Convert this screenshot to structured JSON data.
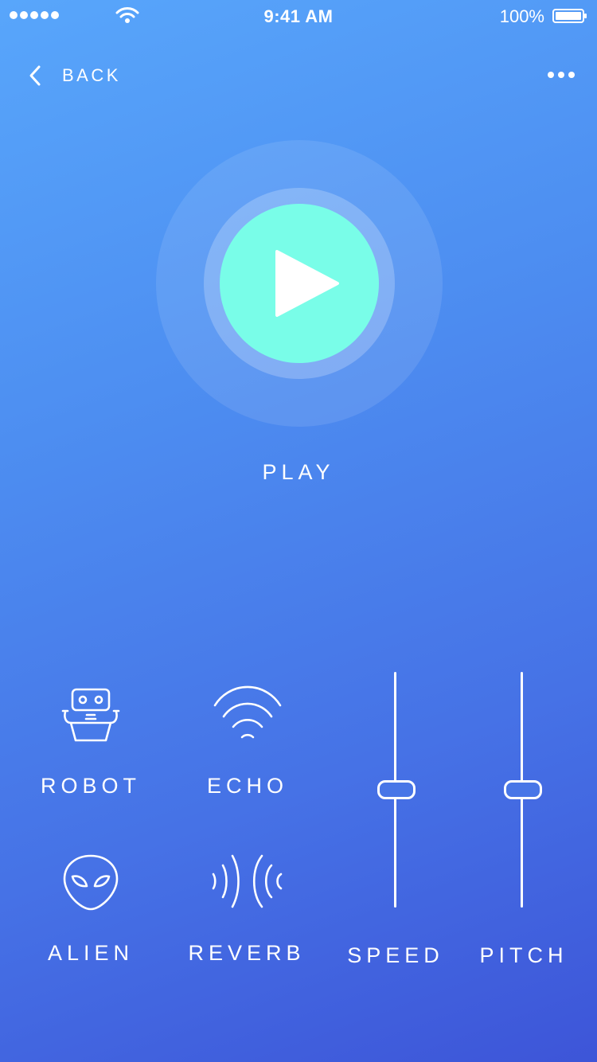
{
  "status_bar": {
    "time": "9:41 AM",
    "battery_percent": "100%",
    "signal_icon": "signal-dots-icon",
    "wifi_icon": "wifi-icon",
    "battery_icon": "battery-icon"
  },
  "nav": {
    "back_label": "BACK",
    "back_icon": "chevron-left-icon",
    "more_icon": "more-dots-icon"
  },
  "player": {
    "play_label": "PLAY",
    "play_icon": "play-icon"
  },
  "effects": [
    {
      "label": "ROBOT",
      "icon": "robot-icon"
    },
    {
      "label": "ECHO",
      "icon": "echo-waves-icon"
    },
    {
      "label": "ALIEN",
      "icon": "alien-head-icon"
    },
    {
      "label": "REVERB",
      "icon": "reverb-waves-icon"
    }
  ],
  "sliders": [
    {
      "label": "SPEED",
      "value": 0.5
    },
    {
      "label": "PITCH",
      "value": 0.5
    }
  ],
  "colors": {
    "background_top": "#58a6fb",
    "background_bottom": "#3d55d8",
    "play_button": "#79fde8",
    "foreground": "#ffffff"
  }
}
